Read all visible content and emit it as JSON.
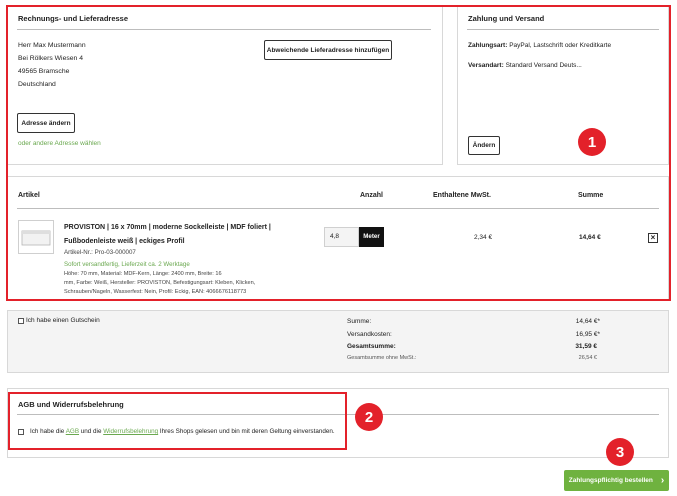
{
  "billing": {
    "title": "Rechnungs- und Lieferadresse",
    "name": "Herr Max Mustermann",
    "street": "Bei Rölkers Wiesen 4",
    "city": "49565 Bramsche",
    "country": "Deutschland",
    "alt_address_button": "Abweichende Lieferadresse hinzufügen",
    "change_address_button": "Adresse ändern",
    "other_address_link": "oder andere Adresse wählen"
  },
  "payment": {
    "title": "Zahlung und Versand",
    "payment_label": "Zahlungsart:",
    "payment_value": "PayPal, Lastschrift oder Kreditkarte",
    "shipping_label": "Versandart:",
    "shipping_value": "Standard Versand Deuts...",
    "change_button": "Ändern"
  },
  "cart": {
    "headers": {
      "article": "Artikel",
      "quantity": "Anzahl",
      "tax": "Enthaltene MwSt.",
      "sum": "Summe"
    },
    "item": {
      "title_line1": "PROVISTON | 16 x 70mm | moderne Sockelleiste | MDF foliert |",
      "title_line2": "Fußbodenleiste weiß | eckiges Profil",
      "article_no": "Artikel-Nr.: Pro-03-000007",
      "availability": "Sofort versandfertig, Lieferzeit ca. 2 Werktage",
      "desc_line1": "Höhe: 70 mm, Material: MDF-Kern, Länge: 2400 mm, Breite: 16",
      "desc_line2": "mm, Farbe: Weiß, Hersteller: PROVISTON, Befestigungsart: Kleben, Klicken,",
      "desc_line3": "Schrauben/Nageln, Wasserfest: Nein, Profil: Eckig, EAN: 4066676118773",
      "quantity": "4,8",
      "unit": "Meter",
      "tax": "2,34 €",
      "sum": "14,64 €",
      "remove_icon": "×"
    }
  },
  "summary": {
    "voucher_label": "Ich habe einen Gutschein",
    "subtotal_label": "Summe:",
    "subtotal_value": "14,64 €*",
    "shipping_label": "Versandkosten:",
    "shipping_value": "16,95 €*",
    "total_label": "Gesamtsumme:",
    "total_value": "31,59 €",
    "net_label": "Gesamtsumme ohne MwSt.:",
    "net_value": "26,54 €"
  },
  "terms": {
    "title": "AGB und Widerrufsbelehrung",
    "text_pre": "Ich habe die",
    "agb_link": "AGB",
    "text_mid": "und die",
    "withdrawal_link": "Widerrufsbelehrung",
    "text_post": "Ihres Shops gelesen und bin mit deren Geltung einverstanden."
  },
  "order_button": {
    "label": "Zahlungspflichtig bestellen",
    "chevron": "›"
  },
  "badges": [
    "1",
    "2",
    "3"
  ],
  "colors": {
    "accent_green": "#6aa84f",
    "annotation_red": "#e3212a",
    "button_green": "#6fb23f"
  }
}
